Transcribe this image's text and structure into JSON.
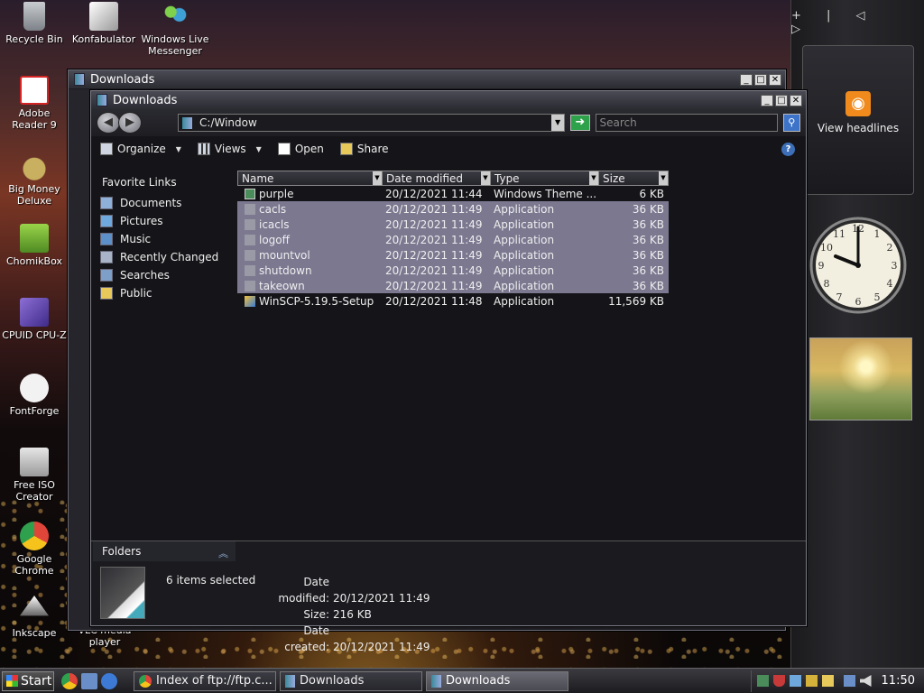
{
  "desktop": {
    "icons": [
      {
        "label": "Recycle Bin",
        "color": "#9aa0a6"
      },
      {
        "label": "Konfabulator",
        "color": "#c9c9c9"
      },
      {
        "label": "Windows Live Messenger",
        "color": "#3fa0d8"
      },
      {
        "label": "Adobe Reader 9",
        "color": "#d42424"
      },
      {
        "label": "Big Money Deluxe",
        "color": "#c8b060"
      },
      {
        "label": "ChomikBox",
        "color": "#7ab83a"
      },
      {
        "label": "CPUID CPU-Z",
        "color": "#6a4fb0"
      },
      {
        "label": "FontForge",
        "color": "#f2f2f2"
      },
      {
        "label": "Free ISO Creator",
        "color": "#d0d0d0"
      },
      {
        "label": "Google Chrome",
        "color": "#e0453a"
      },
      {
        "label": "Inkscape",
        "color": "#eeeeee"
      },
      {
        "label": "VLC media player",
        "color": "#f08a1c"
      }
    ]
  },
  "sidebar": {
    "top_controls": "+ | ◁ ▷",
    "news_label": "View headlines"
  },
  "back_window": {
    "title": "Downloads"
  },
  "window": {
    "title": "Downloads",
    "address": "C:/Window",
    "search_placeholder": "Search",
    "toolbar": {
      "organize": "Organize",
      "views": "Views",
      "open": "Open",
      "share": "Share"
    },
    "favorite_links_title": "Favorite Links",
    "favorite_links": [
      "Documents",
      "Pictures",
      "Music",
      "Recently Changed",
      "Searches",
      "Public"
    ],
    "columns": {
      "name": "Name",
      "date": "Date modified",
      "type": "Type",
      "size": "Size"
    },
    "files": [
      {
        "name": "purple",
        "date": "20/12/2021 11:44",
        "type": "Windows Theme ...",
        "size": "6 KB",
        "selected": false
      },
      {
        "name": "cacls",
        "date": "20/12/2021 11:49",
        "type": "Application",
        "size": "36 KB",
        "selected": true
      },
      {
        "name": "icacls",
        "date": "20/12/2021 11:49",
        "type": "Application",
        "size": "36 KB",
        "selected": true
      },
      {
        "name": "logoff",
        "date": "20/12/2021 11:49",
        "type": "Application",
        "size": "36 KB",
        "selected": true
      },
      {
        "name": "mountvol",
        "date": "20/12/2021 11:49",
        "type": "Application",
        "size": "36 KB",
        "selected": true
      },
      {
        "name": "shutdown",
        "date": "20/12/2021 11:49",
        "type": "Application",
        "size": "36 KB",
        "selected": true
      },
      {
        "name": "takeown",
        "date": "20/12/2021 11:49",
        "type": "Application",
        "size": "36 KB",
        "selected": true
      },
      {
        "name": "WinSCP-5.19.5-Setup",
        "date": "20/12/2021 11:48",
        "type": "Application",
        "size": "11,569 KB",
        "selected": false
      }
    ],
    "folders_label": "Folders",
    "details": {
      "selected_text": "6 items selected",
      "date_modified_label": "Date modified:",
      "date_modified": "20/12/2021 11:49",
      "size_label": "Size:",
      "size": "216 KB",
      "date_created_label": "Date created:",
      "date_created": "20/12/2021 11:49"
    }
  },
  "taskbar": {
    "start_label": "Start",
    "tasks": [
      {
        "label": "Index of ftp://ftp.c...",
        "active": false
      },
      {
        "label": "Downloads",
        "active": false
      },
      {
        "label": "Downloads",
        "active": true
      }
    ],
    "clock": "11:50"
  },
  "colors": {
    "selection": "#7b7890",
    "accent": "#3d74c9"
  }
}
